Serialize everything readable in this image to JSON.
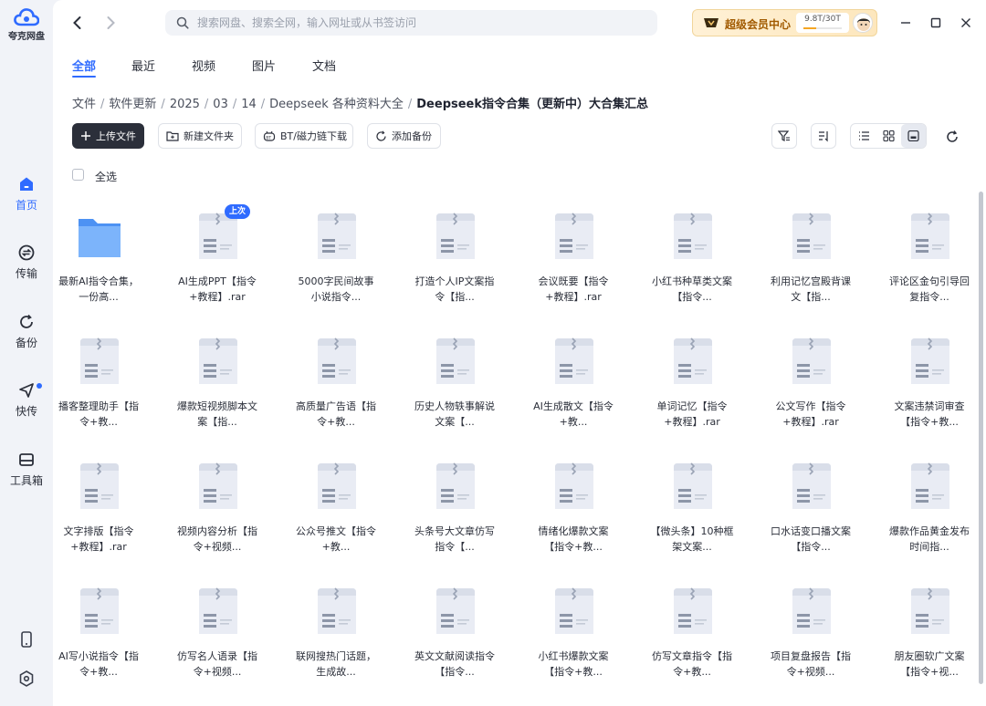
{
  "app": {
    "logo_text": "夸克网盘",
    "accent": "#2f6bff"
  },
  "sidebar": {
    "items": [
      {
        "label": "首页",
        "icon": "home-icon",
        "active": true
      },
      {
        "label": "传输",
        "icon": "transfer-icon",
        "active": false
      },
      {
        "label": "备份",
        "icon": "backup-icon",
        "active": false
      },
      {
        "label": "快传",
        "icon": "quick-send-icon",
        "active": false,
        "dot": true
      },
      {
        "label": "工具箱",
        "icon": "toolbox-icon",
        "active": false
      }
    ],
    "bottom_icons": [
      "phone-icon",
      "settings-icon"
    ]
  },
  "search": {
    "placeholder": "搜索网盘、搜索全网，输入网址或从书签访问"
  },
  "vip": {
    "label": "超级会员中心",
    "quota": "9.8T/30T",
    "usage_fraction": 0.33
  },
  "tabs": [
    {
      "label": "全部",
      "active": true
    },
    {
      "label": "最近",
      "active": false
    },
    {
      "label": "视频",
      "active": false
    },
    {
      "label": "图片",
      "active": false
    },
    {
      "label": "文档",
      "active": false
    }
  ],
  "breadcrumb": [
    "文件",
    "软件更新",
    "2025",
    "03",
    "14",
    "Deepseek 各种资料大全",
    "Deepseek指令合集（更新中）大合集汇总"
  ],
  "toolbar": {
    "upload": "上传文件",
    "new_folder": "新建文件夹",
    "bt": "BT/磁力链下载",
    "backup": "添加备份"
  },
  "select_all": "全选",
  "files": [
    {
      "name": "最新AI指令合集，一份高...",
      "type": "folder"
    },
    {
      "name": "AI生成PPT【指令+教程】.rar",
      "type": "archive",
      "badge": "上次"
    },
    {
      "name": "5000字民间故事小说指令...",
      "type": "archive"
    },
    {
      "name": "打造个人IP文案指令【指...",
      "type": "archive"
    },
    {
      "name": "会议既要【指令+教程】.rar",
      "type": "archive"
    },
    {
      "name": "小红书种草类文案【指令...",
      "type": "archive"
    },
    {
      "name": "利用记忆宫殿背课文【指...",
      "type": "archive"
    },
    {
      "name": "评论区金句引导回复指令...",
      "type": "archive"
    },
    {
      "name": "播客整理助手【指令+教...",
      "type": "archive"
    },
    {
      "name": "爆款短视频脚本文案【指...",
      "type": "archive"
    },
    {
      "name": "高质量广告语【指令+教...",
      "type": "archive"
    },
    {
      "name": "历史人物轶事解说文案【...",
      "type": "archive"
    },
    {
      "name": "AI生成散文【指令+教...",
      "type": "archive"
    },
    {
      "name": "单词记忆【指令+教程】.rar",
      "type": "archive"
    },
    {
      "name": "公文写作【指令+教程】.rar",
      "type": "archive"
    },
    {
      "name": "文案违禁词审查【指令+教...",
      "type": "archive"
    },
    {
      "name": "文字排版【指令+教程】.rar",
      "type": "archive"
    },
    {
      "name": "视频内容分析【指令+视频...",
      "type": "archive"
    },
    {
      "name": "公众号推文【指令+教...",
      "type": "archive"
    },
    {
      "name": "头条号大文章仿写指令【...",
      "type": "archive"
    },
    {
      "name": "情绪化爆款文案【指令+教...",
      "type": "archive"
    },
    {
      "name": "【微头条】10种框架文案...",
      "type": "archive"
    },
    {
      "name": "口水话变口播文案【指令...",
      "type": "archive"
    },
    {
      "name": "爆款作品黄金发布时间指...",
      "type": "archive"
    },
    {
      "name": "AI写小说指令【指令+教...",
      "type": "archive"
    },
    {
      "name": "仿写名人语录【指令+视频...",
      "type": "archive"
    },
    {
      "name": "联网搜热门话题，生成故...",
      "type": "archive"
    },
    {
      "name": "英文文献阅读指令【指令...",
      "type": "archive"
    },
    {
      "name": "小红书爆款文案【指令+教...",
      "type": "archive"
    },
    {
      "name": "仿写文章指令【指令+教...",
      "type": "archive"
    },
    {
      "name": "项目复盘报告【指令+视频...",
      "type": "archive"
    },
    {
      "name": "朋友圈软广文案【指令+视...",
      "type": "archive"
    }
  ]
}
